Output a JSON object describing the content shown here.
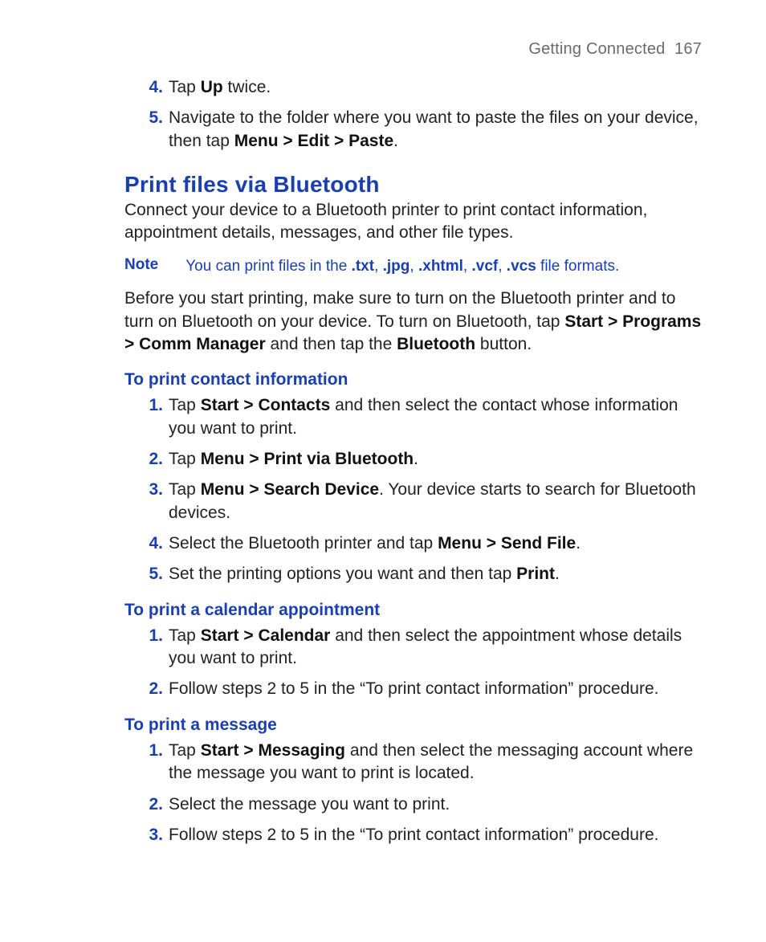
{
  "header": {
    "section": "Getting Connected",
    "page_number": "167"
  },
  "top_steps": [
    {
      "n": "4.",
      "pre": "Tap ",
      "b1": "Up",
      "post": " twice."
    },
    {
      "n": "5.",
      "text_a": "Navigate to the folder where you want to paste the files on your device, then tap ",
      "b1": "Menu > Edit > Paste",
      "text_b": "."
    }
  ],
  "h2": "Print files via Bluetooth",
  "intro": "Connect your device to a Bluetooth printer to print contact information, appointment details, messages, and other file types.",
  "note": {
    "label": "Note",
    "pre": "You can print files in the ",
    "f1": ".txt",
    "c1": ", ",
    "f2": ".jpg",
    "c2": ", ",
    "f3": ".xhtml",
    "c3": ", ",
    "f4": ".vcf",
    "c4": ", ",
    "f5": ".vcs",
    "post": " file formats."
  },
  "before": {
    "a": "Before you start printing, make sure to turn on the Bluetooth printer and to turn on Bluetooth on your device. To turn on Bluetooth, tap ",
    "b1": "Start > Programs > Comm Manager",
    "b": " and then tap the ",
    "b2": "Bluetooth",
    "c": " button."
  },
  "sections": {
    "contact": {
      "title": "To print contact information",
      "steps": [
        {
          "n": "1.",
          "a": "Tap ",
          "b1": "Start > Contacts",
          "b": " and then select the contact whose information you want to print."
        },
        {
          "n": "2.",
          "a": "Tap ",
          "b1": "Menu > Print via Bluetooth",
          "b": "."
        },
        {
          "n": "3.",
          "a": "Tap ",
          "b1": "Menu > Search Device",
          "b": ". Your device starts to search for Bluetooth devices."
        },
        {
          "n": "4.",
          "a": "Select the Bluetooth printer and tap ",
          "b1": "Menu > Send File",
          "b": "."
        },
        {
          "n": "5.",
          "a": "Set the printing options you want and then tap ",
          "b1": "Print",
          "b": "."
        }
      ]
    },
    "calendar": {
      "title": "To print a calendar appointment",
      "steps": [
        {
          "n": "1.",
          "a": "Tap ",
          "b1": "Start > Calendar",
          "b": " and then select the appointment whose details you want to print."
        },
        {
          "n": "2.",
          "a": "Follow steps 2 to 5 in the “To print contact information” procedure."
        }
      ]
    },
    "message": {
      "title": "To print a message",
      "steps": [
        {
          "n": "1.",
          "a": "Tap ",
          "b1": "Start > Messaging",
          "b": " and then select the messaging account where the message you want to print is located."
        },
        {
          "n": "2.",
          "a": "Select the message you want to print."
        },
        {
          "n": "3.",
          "a": " Follow steps 2 to 5 in the “To print contact information” procedure."
        }
      ]
    }
  }
}
